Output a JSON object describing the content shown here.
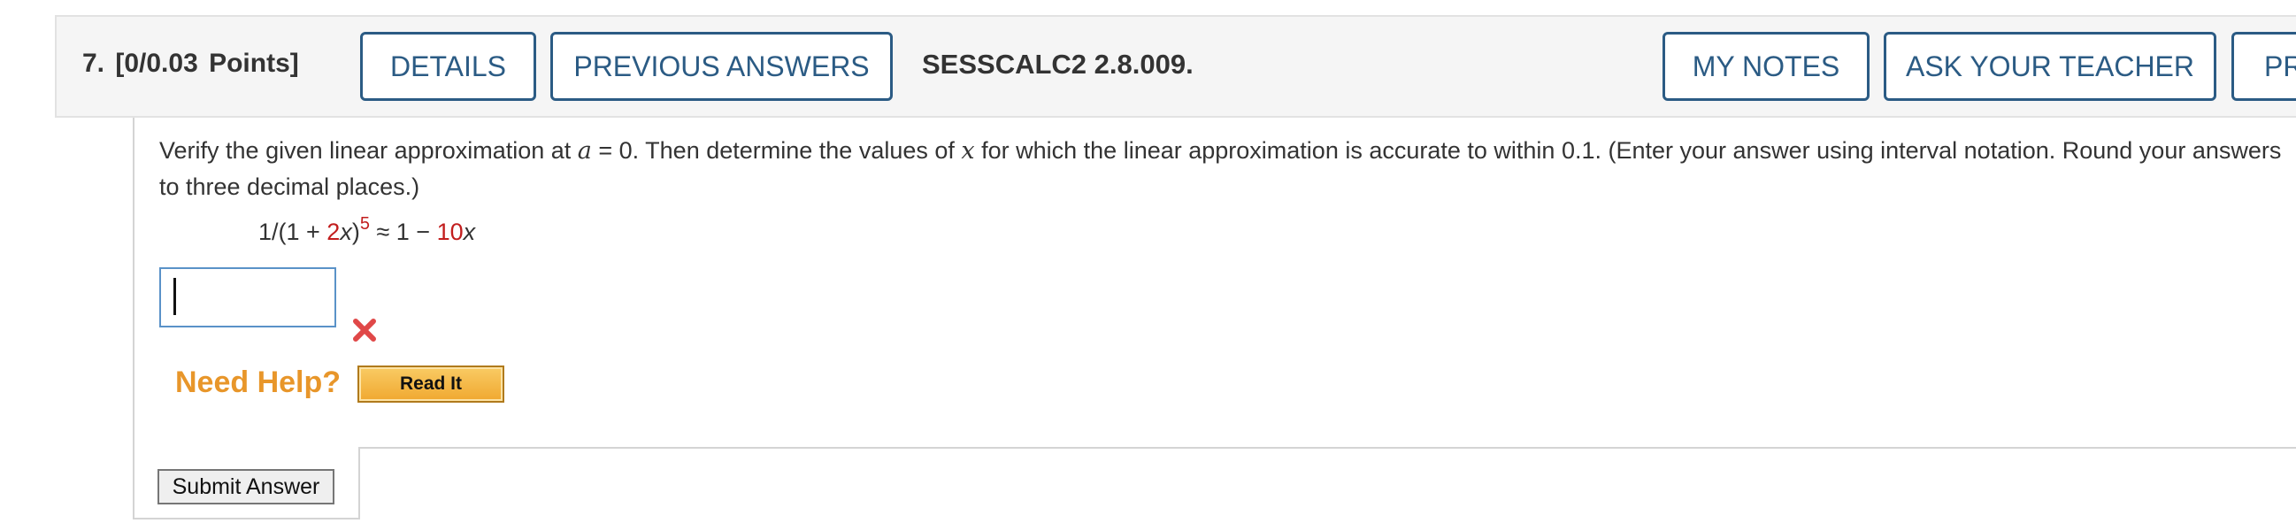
{
  "question": {
    "number_points": "7.  [0/0.03 Points]",
    "course_code": "SESSCALC2 2.8.009."
  },
  "toolbar": {
    "details_label": "DETAILS",
    "previous_answers_label": "PREVIOUS ANSWERS",
    "my_notes_label": "MY NOTES",
    "ask_teacher_label": "ASK YOUR TEACHER",
    "practice_label": "PRA"
  },
  "prompt": {
    "part1": "Verify the given linear approximation at ",
    "var_a": "a",
    "part2": " = 0.  Then determine the values of ",
    "var_x": "x",
    "part3": " for which the linear approximation is accurate to within 0.1. (Enter your answer using interval notation. Round your answers to three decimal places.)"
  },
  "formula": {
    "prefix": "1/(1 + ",
    "coef": "2",
    "var": "x",
    "close": ")",
    "exponent": "5",
    "approx": " ≈ 1 − ",
    "rhs_coef": "10",
    "rhs_var": "x"
  },
  "answer": {
    "value": "",
    "status_icon": "wrong-x-icon",
    "status_color": "#e04848"
  },
  "help": {
    "label": "Need Help?",
    "read_it_label": "Read It"
  },
  "submit": {
    "label": "Submit Answer"
  },
  "colors": {
    "accent": "#2b5b84",
    "highlight_red": "#c21e1e",
    "help_orange": "#e8962a"
  }
}
